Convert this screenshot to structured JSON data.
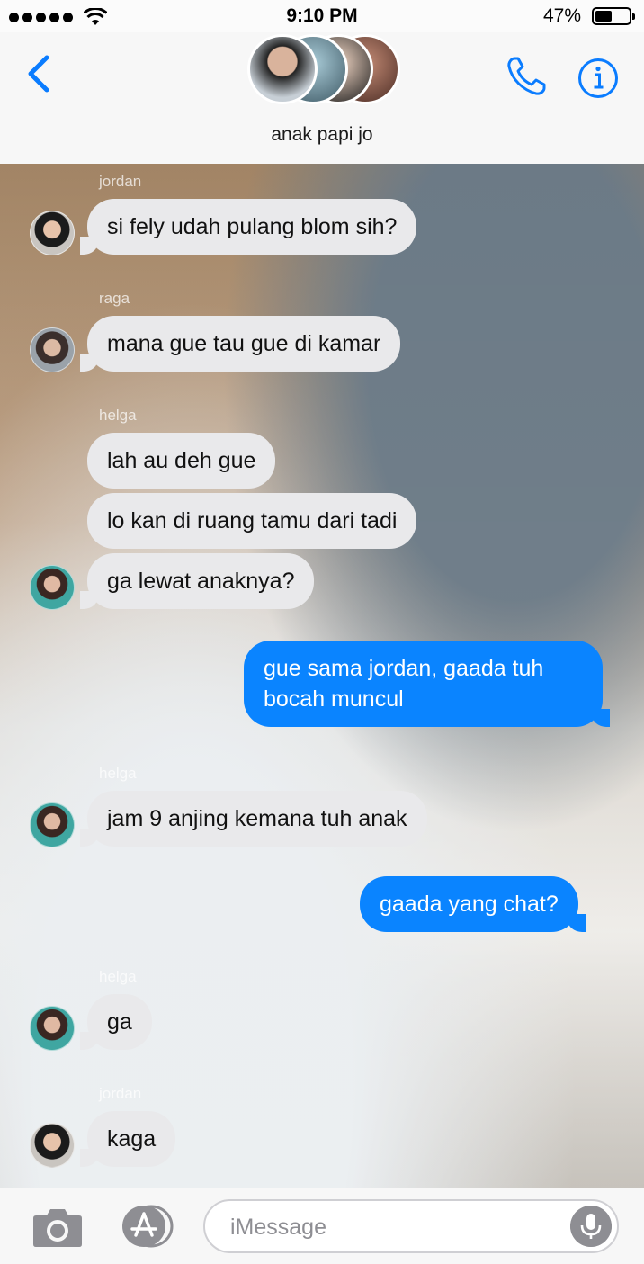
{
  "status_bar": {
    "time": "9:10 PM",
    "battery": "47%",
    "battery_level": 0.47
  },
  "header": {
    "group_name": "anak papi jo"
  },
  "messages": [
    {
      "sender": "jordan",
      "text": "si fely udah pulang blom sih?"
    },
    {
      "sender": "raga",
      "text": "mana gue tau gue di kamar"
    },
    {
      "sender": "helga",
      "text": "lah au deh gue"
    },
    {
      "text": "lo kan di ruang tamu dari tadi"
    },
    {
      "text": "ga lewat anaknya?"
    },
    {
      "outgoing": true,
      "text": "gue sama jordan, gaada tuh bocah muncul"
    },
    {
      "sender": "helga",
      "text": "jam 9 anjing kemana tuh anak"
    },
    {
      "outgoing": true,
      "text": "gaada yang chat?"
    },
    {
      "sender": "helga",
      "text": "ga"
    },
    {
      "sender": "jordan",
      "text": "kaga"
    }
  ],
  "input": {
    "placeholder": "iMessage"
  },
  "colors": {
    "accent": "#0a84ff",
    "incoming_bubble": "#e9e9eb"
  },
  "icons": [
    "back-chevron-icon",
    "phone-icon",
    "info-icon",
    "camera-icon",
    "app-store-icon",
    "microphone-icon"
  ]
}
